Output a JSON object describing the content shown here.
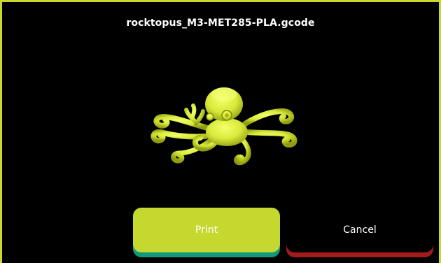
{
  "dialog": {
    "file_name": "rocktopus_M3-MET285-PLA.gcode",
    "preview_icon": "octopus-model-preview"
  },
  "actions": {
    "print_label": "Print",
    "cancel_label": "Cancel"
  },
  "colors": {
    "accent": "#c5d82f",
    "print_button_shadow": "#0f9a7d",
    "cancel_button_shadow": "#a31b1b",
    "background": "#000000",
    "frame": "#c8d82e"
  }
}
